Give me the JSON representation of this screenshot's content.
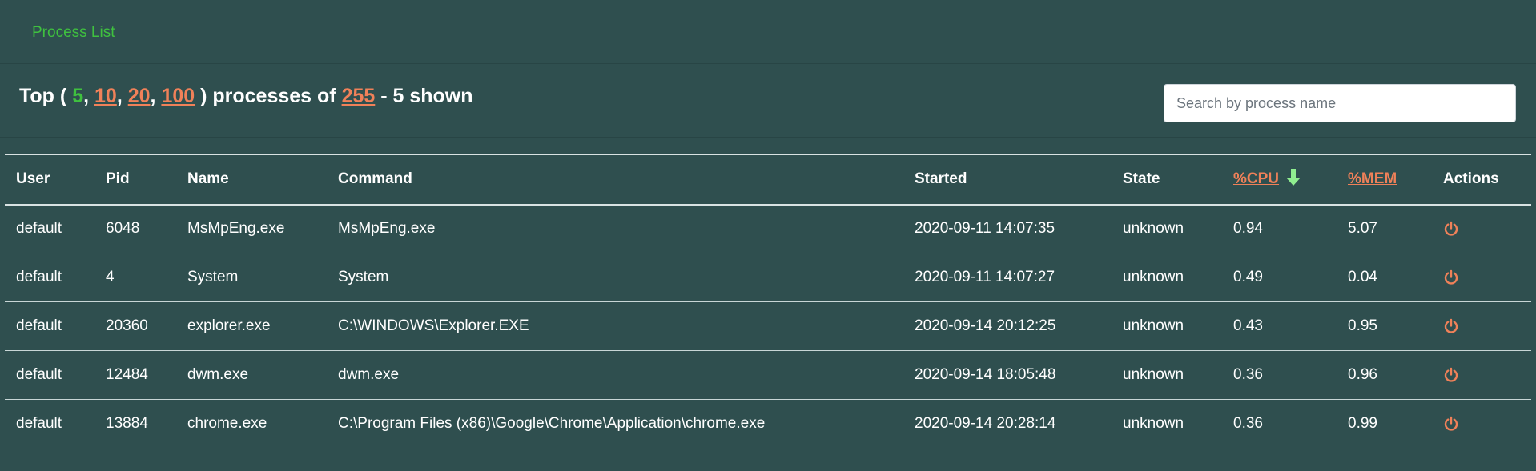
{
  "nav": {
    "process_list_link": "Process List"
  },
  "summary": {
    "prefix": "Top ( ",
    "counts": [
      "5",
      "10",
      "20",
      "100"
    ],
    "separator": ", ",
    "middle": " ) processes of ",
    "total": "255",
    "suffix": " - 5 shown"
  },
  "search": {
    "placeholder": "Search by process name",
    "value": ""
  },
  "table": {
    "headers": {
      "user": "User",
      "pid": "Pid",
      "name": "Name",
      "command": "Command",
      "started": "Started",
      "state": "State",
      "cpu": "%CPU",
      "mem": "%MEM",
      "actions": "Actions"
    },
    "sort_icon": "arrow-down-icon",
    "rows": [
      {
        "user": "default",
        "pid": "6048",
        "name": "MsMpEng.exe",
        "command": "MsMpEng.exe",
        "started": "2020-09-11 14:07:35",
        "state": "unknown",
        "cpu": "0.94",
        "mem": "5.07"
      },
      {
        "user": "default",
        "pid": "4",
        "name": "System",
        "command": "System",
        "started": "2020-09-11 14:07:27",
        "state": "unknown",
        "cpu": "0.49",
        "mem": "0.04"
      },
      {
        "user": "default",
        "pid": "20360",
        "name": "explorer.exe",
        "command": "C:\\WINDOWS\\Explorer.EXE",
        "started": "2020-09-14 20:12:25",
        "state": "unknown",
        "cpu": "0.43",
        "mem": "0.95"
      },
      {
        "user": "default",
        "pid": "12484",
        "name": "dwm.exe",
        "command": "dwm.exe",
        "started": "2020-09-14 18:05:48",
        "state": "unknown",
        "cpu": "0.36",
        "mem": "0.96"
      },
      {
        "user": "default",
        "pid": "13884",
        "name": "chrome.exe",
        "command": "C:\\Program Files (x86)\\Google\\Chrome\\Application\\chrome.exe",
        "started": "2020-09-14 20:28:14",
        "state": "unknown",
        "cpu": "0.36",
        "mem": "0.99"
      }
    ],
    "action_icon": "power-icon"
  },
  "colors": {
    "background": "#2f4f4f",
    "active_green": "#3fc13f",
    "link_orange": "#f08159",
    "sort_arrow": "#90ee90"
  }
}
